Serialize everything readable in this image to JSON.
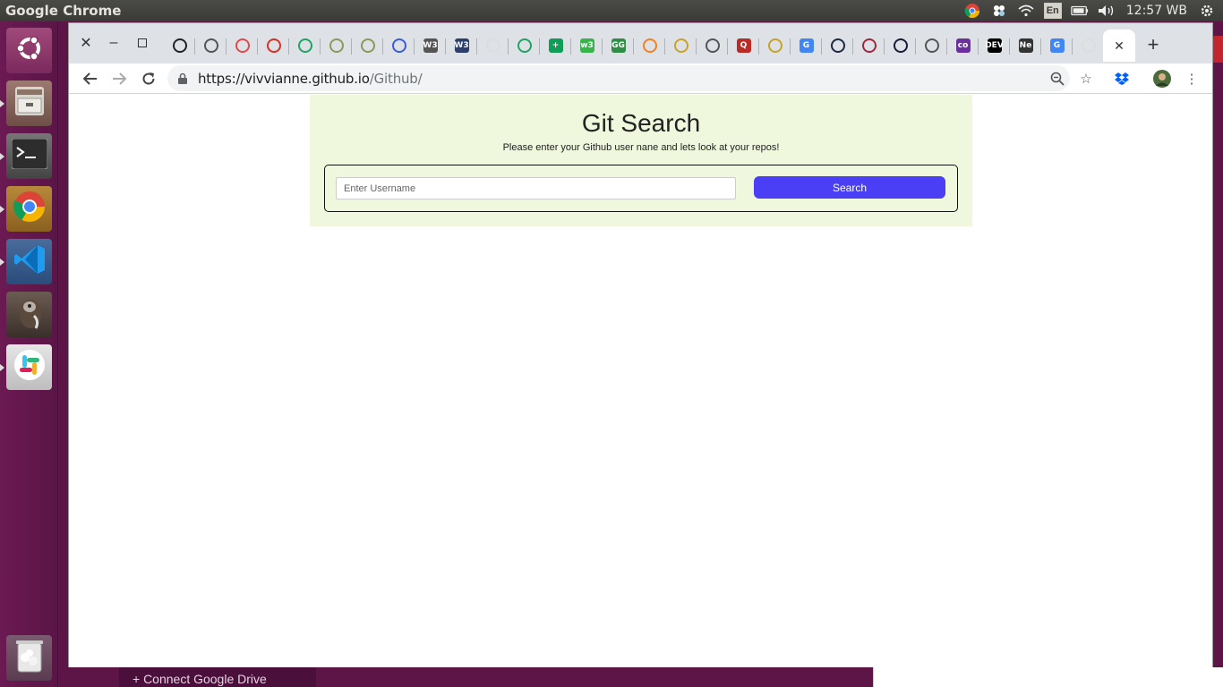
{
  "topbar": {
    "app_title": "Google Chrome",
    "keyboard_layout": "En",
    "clock": "12:57 WB"
  },
  "launcher": {
    "items": [
      "ubuntu-dash",
      "files",
      "terminal",
      "chrome",
      "vscode",
      "gimp",
      "slack",
      "trash"
    ]
  },
  "desktop": {
    "connect_drive": "+ Connect Google Drive"
  },
  "browser": {
    "url_host": "https://vivvianne.github.io",
    "url_path": "/Github/",
    "tabs": [
      {
        "icon": "github-icon",
        "color": "#222"
      },
      {
        "icon": "globe-icon",
        "color": "#555"
      },
      {
        "icon": "kaggle-icon",
        "color": "#e04b4b"
      },
      {
        "icon": "gmail-icon",
        "color": "#d93025"
      },
      {
        "icon": "drive-icon",
        "color": "#1fa463"
      },
      {
        "icon": "tree-icon",
        "color": "#8a9a5b"
      },
      {
        "icon": "tree-icon",
        "color": "#8a9a5b"
      },
      {
        "icon": "upwork-icon",
        "color": "#3b5bdb"
      },
      {
        "icon": "w3schools-icon",
        "color": "#555",
        "text": "W3"
      },
      {
        "icon": "w3-icon",
        "color": "#2c3e6b",
        "text": "W3"
      },
      {
        "icon": "camera-icon",
        "color": "#ddd"
      },
      {
        "icon": "drive-icon",
        "color": "#1fa463"
      },
      {
        "icon": "sheets-icon",
        "color": "#0f9d58",
        "text": "+"
      },
      {
        "icon": "freecodecamp-icon",
        "color": "#37b44a",
        "text": "w3"
      },
      {
        "icon": "geeksforgeeks-icon",
        "color": "#2f8d46",
        "text": "GG"
      },
      {
        "icon": "stackoverflow-icon",
        "color": "#f48024"
      },
      {
        "icon": "globe-icon",
        "color": "#c8a32a"
      },
      {
        "icon": "globe-icon",
        "color": "#555"
      },
      {
        "icon": "quora-icon",
        "color": "#b92b27",
        "text": "Q"
      },
      {
        "icon": "globe-icon",
        "color": "#c8a32a"
      },
      {
        "icon": "google-icon",
        "color": "#4285f4",
        "text": "G"
      },
      {
        "icon": "circle-icon",
        "color": "#1d2a44"
      },
      {
        "icon": "grid-icon",
        "color": "#a0283a"
      },
      {
        "icon": "notion-icon",
        "color": "#1a1a3a"
      },
      {
        "icon": "globe-icon",
        "color": "#555"
      },
      {
        "icon": "coolors-icon",
        "color": "#6b2fa0",
        "text": "co"
      },
      {
        "icon": "dev-icon",
        "color": "#000",
        "text": "DEV"
      },
      {
        "icon": "netflix-icon",
        "color": "#333",
        "text": "Ne"
      },
      {
        "icon": "google-icon",
        "color": "#4285f4",
        "text": "G"
      },
      {
        "icon": "camera-icon",
        "color": "#ddd"
      }
    ]
  },
  "page": {
    "title": "Git Search",
    "subtitle": "Please enter your Github user nane and lets look at your repos!",
    "search_placeholder": "Enter Username",
    "search_button": "Search"
  },
  "colors": {
    "hero_bg": "#eff7dc",
    "button_bg": "#4a3ff5"
  }
}
